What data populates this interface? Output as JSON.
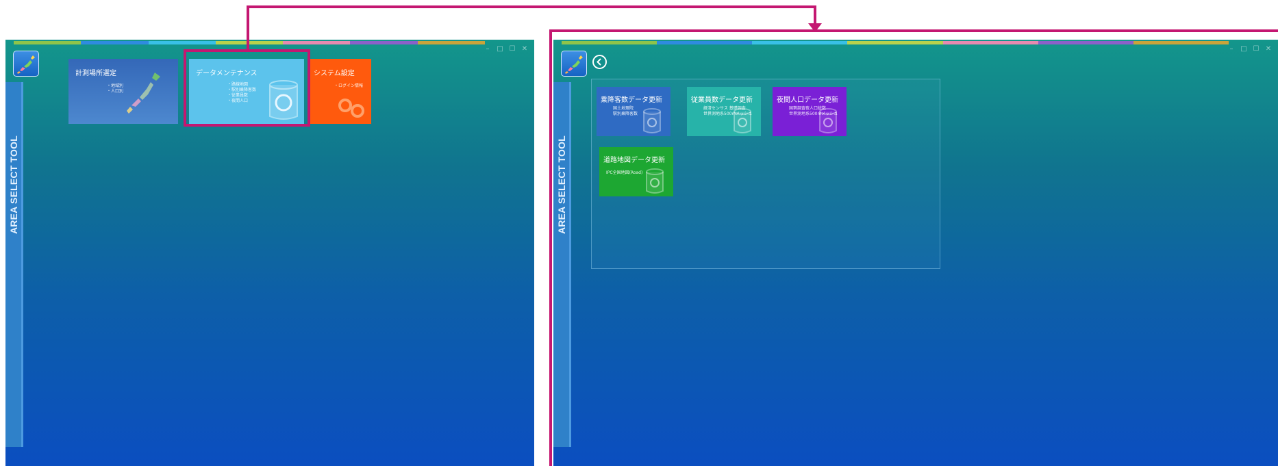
{
  "left_window": {
    "sidebar_label": "AREA SELECT TOOL",
    "tiles": [
      {
        "title": "計測場所選定",
        "subtitle": "・地域別\n・人口別",
        "color": "#3f74c4"
      },
      {
        "title": "データメンテナンス",
        "subtitle": "・路線地図\n・駅別乗降客数\n・従業員数\n・夜間人口",
        "color": "#5cc3ec"
      },
      {
        "title": "システム設定",
        "subtitle": "・ログイン情報",
        "color": "#ff5a0d"
      }
    ]
  },
  "right_window": {
    "sidebar_label": "AREA SELECT TOOL",
    "tiles": [
      {
        "title": "乗降客数データ更新",
        "subtitle": "国土地理院\n駅別乗降客数",
        "color": "#2f6bc3"
      },
      {
        "title": "従業員数データ更新",
        "subtitle": "経済センサス 基礎調査\n世界測地系500mメッシュ",
        "color": "#27b3a9"
      },
      {
        "title": "夜間人口データ更新",
        "subtitle": "国勢調査夜人口総数\n世界測地系500mメッシュ",
        "color": "#7a20d6"
      },
      {
        "title": "道路地図データ更新",
        "subtitle": "IPC全国地図(Road)",
        "color": "#1da732"
      }
    ]
  },
  "window_controls": [
    "–",
    "□",
    "☐",
    "✕"
  ],
  "colors": {
    "highlight": "#c41771",
    "colorbar": [
      "#8fc44a",
      "#2f8be0",
      "#39c0e6",
      "#b9d24c",
      "#e68ab0",
      "#8b60c9",
      "#c9a43a"
    ]
  }
}
